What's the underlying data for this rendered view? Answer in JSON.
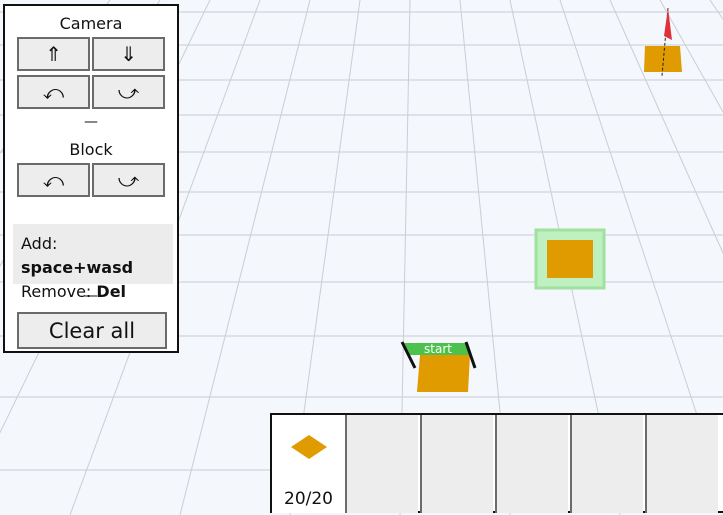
{
  "panel": {
    "camera_title": "Camera",
    "camera_buttons": [
      "⇑",
      "⇓",
      "⤺",
      "⤻"
    ],
    "separator": "—",
    "block_title": "Block",
    "block_buttons": [
      "⤺",
      "⤻"
    ],
    "help": {
      "add_label": "Add:",
      "add_keys": "space+wasd",
      "remove_label": "Remove:",
      "remove_keys": "Del"
    },
    "clear_label": "Clear all"
  },
  "scene": {
    "start_label": "start",
    "block_color": "#e09b00",
    "selection_color": "#7fdc7f",
    "flag_color": "#e0303a",
    "start_banner_color": "#4cc24c"
  },
  "inventory": {
    "count": "20/20",
    "slots": 6
  }
}
